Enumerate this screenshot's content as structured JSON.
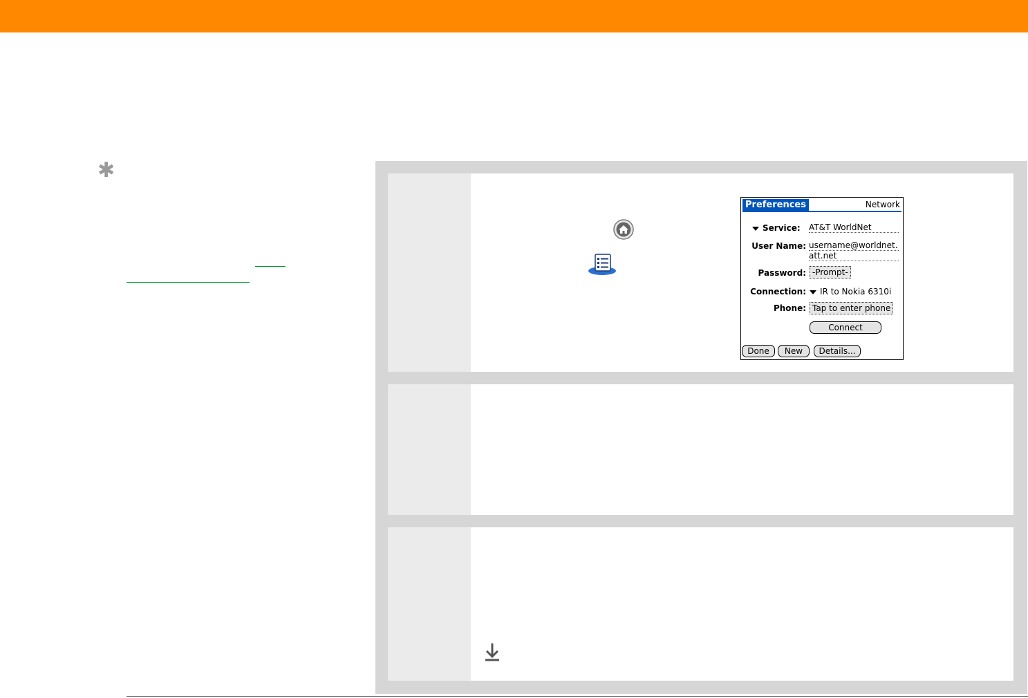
{
  "colors": {
    "header": "#ff8800",
    "panel": "#d6d6d6",
    "step_number_column": "#ebebeb",
    "link": "#009933",
    "palm_title": "#0055bb"
  },
  "icons": {
    "tip": "asterisk-icon",
    "home": "home-icon",
    "prefs": "prefs-app-icon",
    "continue": "down-arrow-icon"
  },
  "sidebar": {
    "tip_mark": "✱"
  },
  "palm": {
    "title": "Preferences",
    "app": "Network",
    "service_label": "Service:",
    "service_value": "AT&T WorldNet",
    "username_label": "User Name:",
    "username_line1": "username@worldnet.",
    "username_line2": "att.net",
    "password_label": "Password:",
    "password_value": "-Prompt-",
    "connection_label": "Connection:",
    "connection_value": "IR to Nokia 6310i",
    "phone_label": "Phone:",
    "phone_value": "Tap to enter phone",
    "connect_button": "Connect",
    "done_button": "Done",
    "new_button": "New",
    "details_button": "Details..."
  }
}
